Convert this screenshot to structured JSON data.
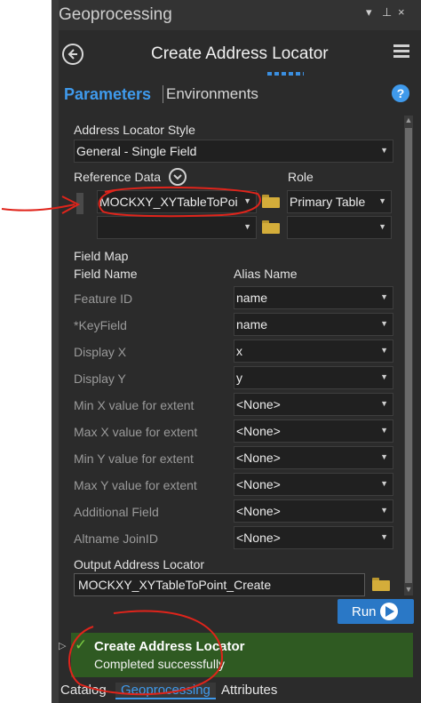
{
  "pane": {
    "title": "Geoprocessing",
    "ctrl_dropdown": "▾",
    "ctrl_pin": "⊥",
    "ctrl_close": "×"
  },
  "header": {
    "tool_title": "Create Address Locator"
  },
  "tabs": {
    "parameters": "Parameters",
    "environments": "Environments",
    "help": "?"
  },
  "params": {
    "style_label": "Address Locator Style",
    "style_value": "General - Single Field",
    "ref_data_label": "Reference Data",
    "role_label": "Role",
    "ref_rows": [
      {
        "table": "MOCKXY_XYTableToPoi",
        "role": "Primary Table"
      },
      {
        "table": "",
        "role": ""
      }
    ],
    "field_map_label": "Field Map",
    "field_name_header": "Field Name",
    "alias_name_header": "Alias Name",
    "fields": [
      {
        "name": "Feature ID",
        "alias": "name"
      },
      {
        "name": "*KeyField",
        "alias": "name"
      },
      {
        "name": "Display X",
        "alias": "x"
      },
      {
        "name": "Display Y",
        "alias": "y"
      },
      {
        "name": "Min X value for extent",
        "alias": "<None>"
      },
      {
        "name": "Max X value for extent",
        "alias": "<None>"
      },
      {
        "name": "Min Y value for extent",
        "alias": "<None>"
      },
      {
        "name": "Max Y value for extent",
        "alias": "<None>"
      },
      {
        "name": "Additional Field",
        "alias": "<None>"
      },
      {
        "name": "Altname JoinID",
        "alias": "<None>"
      }
    ],
    "output_label": "Output Address Locator",
    "output_value": "MOCKXY_XYTableToPoint_Create"
  },
  "run": {
    "label": "Run"
  },
  "status": {
    "title": "Create Address Locator",
    "message": "Completed successfully",
    "expand": "▷"
  },
  "bottom_tabs": [
    "Catalog",
    "Geoprocessing",
    "Attributes"
  ],
  "colors": {
    "accent": "#3f9aec",
    "success": "#2f5a22",
    "annotation": "#e0241b"
  }
}
